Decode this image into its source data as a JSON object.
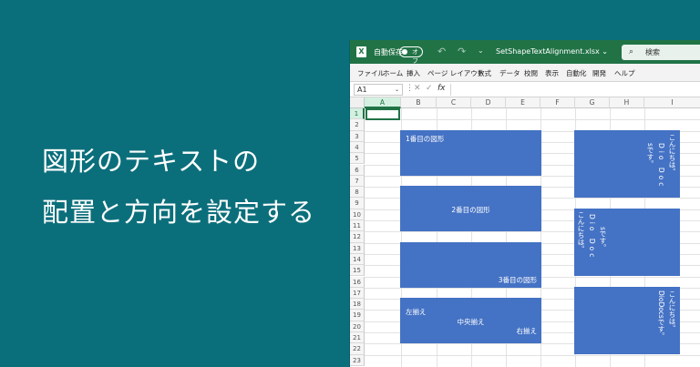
{
  "headline": {
    "line1": "図形のテキストの",
    "line2": "配置と方向を設定する"
  },
  "excel": {
    "titlebar": {
      "app_icon": "X",
      "autosave_label": "自動保存",
      "autosave_state": "オフ",
      "undo_icon": "↶",
      "redo_icon": "↷",
      "quick_access_icon": "⌄",
      "file_name": "SetShapeTextAlignment.xlsx ⌄",
      "search_icon": "⌕",
      "search_placeholder": "検索"
    },
    "ribbon_tabs": [
      "ファイル",
      "ホーム",
      "挿入",
      "ページ レイアウト",
      "数式",
      "データ",
      "校閲",
      "表示",
      "自動化",
      "開発",
      "ヘルプ"
    ],
    "formula_bar": {
      "name_box": "A1",
      "dropdown": "⌄",
      "separator": "⋮",
      "cancel_icon": "✕",
      "enter_icon": "✓",
      "fx_label": "fx"
    },
    "columns": [
      "A",
      "B",
      "C",
      "D",
      "E",
      "F",
      "G",
      "H",
      "I"
    ],
    "rows": [
      "1",
      "2",
      "3",
      "4",
      "5",
      "6",
      "7",
      "8",
      "9",
      "10",
      "11",
      "12",
      "13",
      "14",
      "15",
      "16",
      "17",
      "18",
      "19",
      "20",
      "21",
      "22",
      "23"
    ],
    "selected_cell": "A1",
    "shapes": {
      "shape1": "1番目の図形",
      "shape2": "2番目の図形",
      "shape3": "3番目の図形",
      "shape4_left": "左揃え",
      "shape4_center": "中央揃え",
      "shape4_right": "右揃え",
      "shape5_col1": "こんにちは。",
      "shape5_col2": "Dio Doc",
      "shape5_col3": "sです。",
      "shape6_col1": "sです。",
      "shape6_col2": "Dio Doc",
      "shape6_col3": "こんにちは。",
      "shape7_col1": "こんにちは。",
      "shape7_col2": "DioDocsです。"
    },
    "colors": {
      "excel_green": "#217346",
      "shape_blue": "#4472c4",
      "background_teal": "#0b6f7b"
    }
  }
}
